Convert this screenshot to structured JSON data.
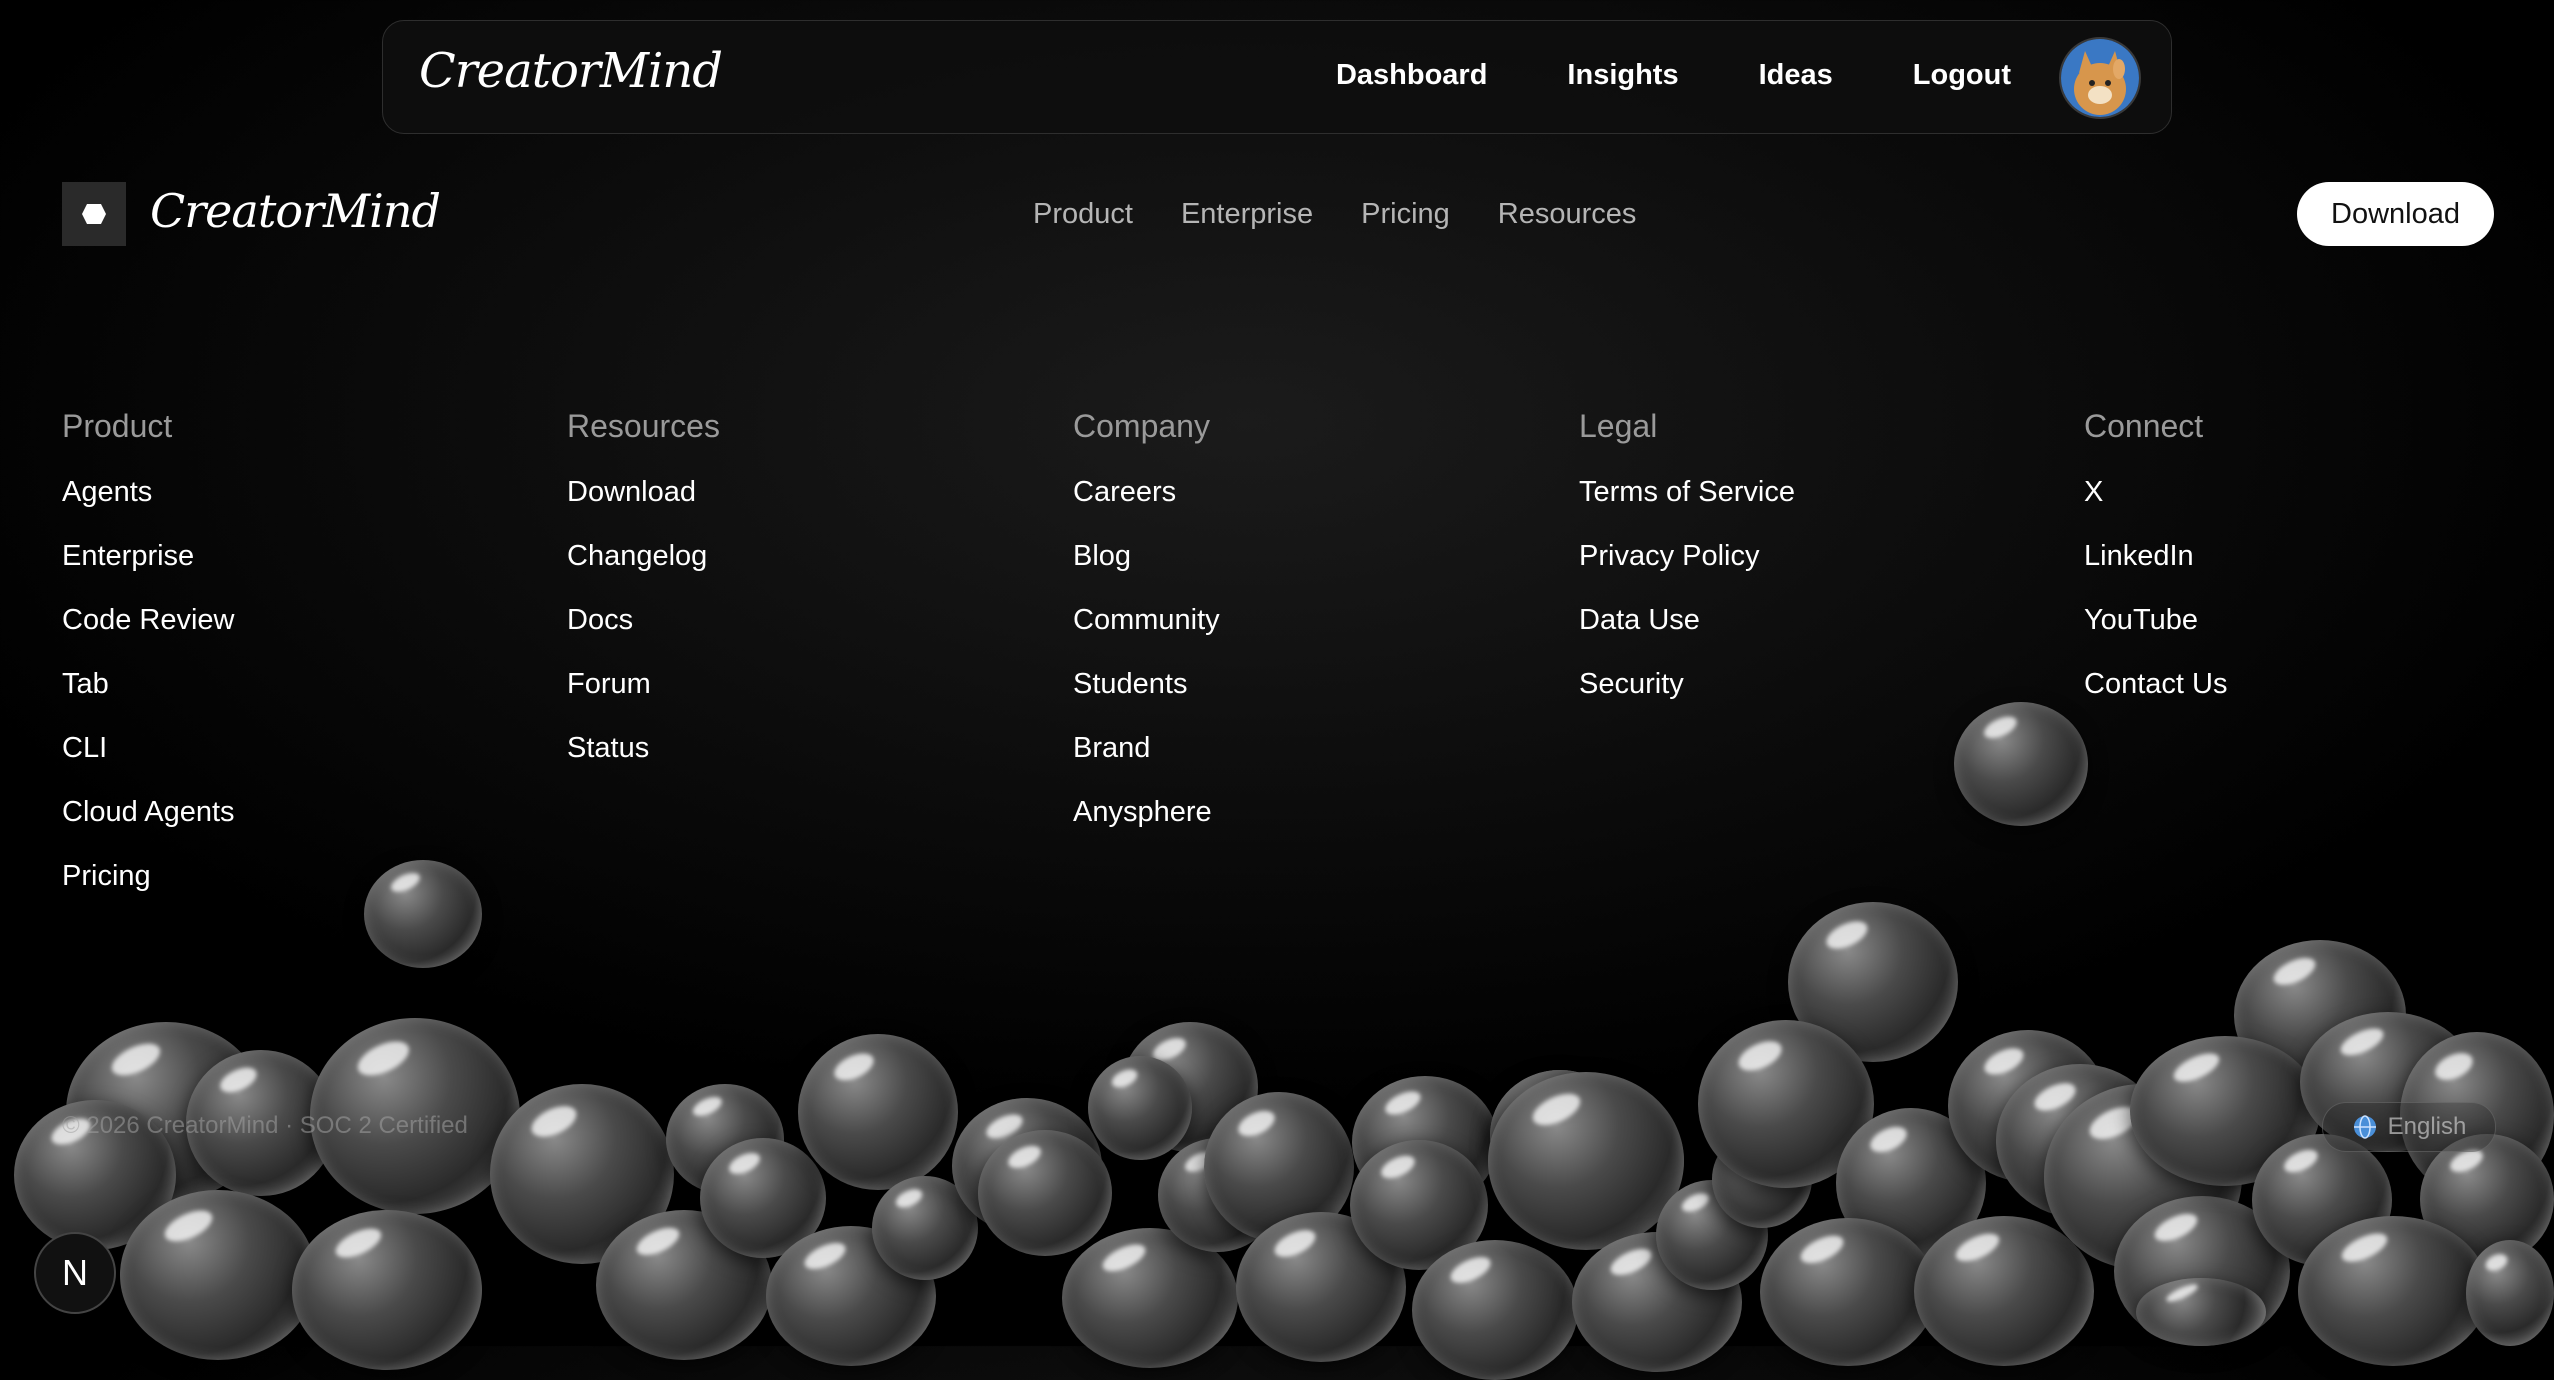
{
  "app_header": {
    "logo": "CreatorMind",
    "nav": [
      "Dashboard",
      "Insights",
      "Ideas",
      "Logout"
    ]
  },
  "site_nav": {
    "logo": "CreatorMind",
    "links": [
      "Product",
      "Enterprise",
      "Pricing",
      "Resources"
    ],
    "download_label": "Download"
  },
  "footer": {
    "columns": [
      {
        "title": "Product",
        "items": [
          "Agents",
          "Enterprise",
          "Code Review",
          "Tab",
          "CLI",
          "Cloud Agents",
          "Pricing"
        ]
      },
      {
        "title": "Resources",
        "items": [
          "Download",
          "Changelog",
          "Docs",
          "Forum",
          "Status"
        ]
      },
      {
        "title": "Company",
        "items": [
          "Careers",
          "Blog",
          "Community",
          "Students",
          "Brand",
          "Anysphere"
        ]
      },
      {
        "title": "Legal",
        "items": [
          "Terms of Service",
          "Privacy Policy",
          "Data Use",
          "Security"
        ]
      },
      {
        "title": "Connect",
        "items": [
          "X",
          "LinkedIn",
          "YouTube",
          "Contact Us"
        ]
      }
    ],
    "copyright": "© 2026 CreatorMind · SOC 2 Certified",
    "language": "English"
  },
  "badge": "N",
  "icons": {
    "logo_mark": "hexagon-icon",
    "language": "globe-icon",
    "avatar": "cat-avatar"
  }
}
